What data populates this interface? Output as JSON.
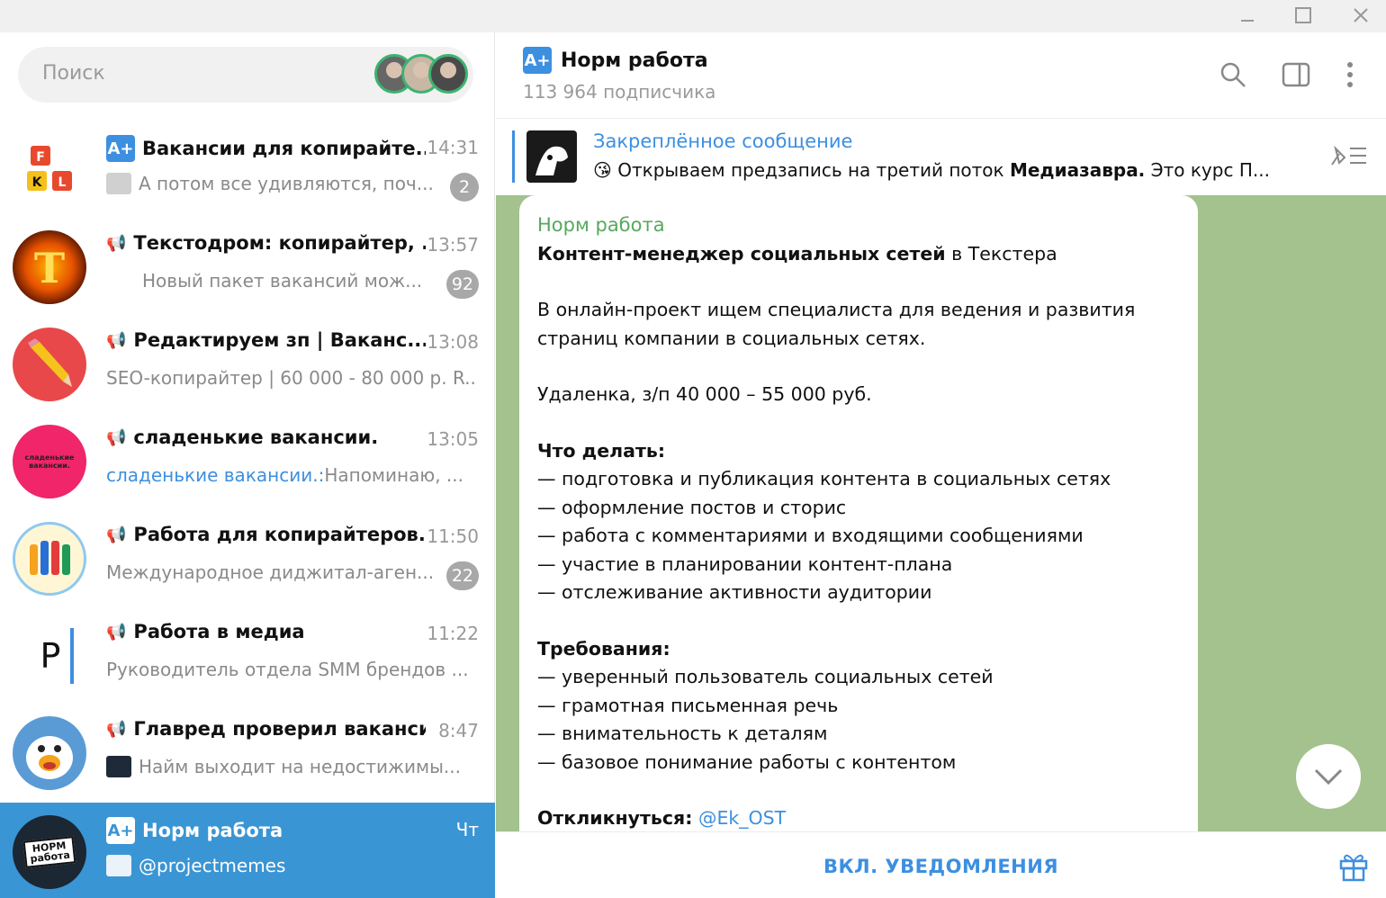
{
  "search": {
    "placeholder": "Поиск"
  },
  "chats": [
    {
      "name": "Вакансии для копирайте...",
      "time": "14:31",
      "preview": "А потом все удивляются,  поч...",
      "badge": "2",
      "icon": "a-plus-icon",
      "avatar_letters": [
        "F",
        "K",
        "L"
      ]
    },
    {
      "name": "Текстодром: копирайтер, ...",
      "time": "13:57",
      "preview": "Новый пакет вакансий мож...",
      "badge": "92",
      "icon": "megaphone-icon",
      "avatar_letters": [
        "T"
      ]
    },
    {
      "name": "Редактируем зп | Ваканс...",
      "time": "13:08",
      "preview": "SEO-копирайтер | 60 000 - 80 000 р. R...",
      "icon": "megaphone-icon"
    },
    {
      "name": "сладенькие вакансии.",
      "time": "13:05",
      "preview_sender": "сладенькие вакансии.:",
      "preview": " Напоминаю, ...",
      "icon": "megaphone-icon",
      "avatar_letters": [
        "сладенькие вакансии."
      ]
    },
    {
      "name": "Работа для копирайтеров...",
      "time": "11:50",
      "preview": "Международное диджитал-аген...",
      "badge": "22",
      "icon": "megaphone-icon"
    },
    {
      "name": "Работа в медиа",
      "time": "11:22",
      "preview": "Руководитель отдела SMM брендов ...",
      "icon": "megaphone-icon",
      "avatar_letters": [
        "Р"
      ]
    },
    {
      "name": "Главред проверил вакансию",
      "time": "8:47",
      "preview": "Найм выходит на недостижимы...",
      "icon": "megaphone-icon"
    },
    {
      "name": "Норм работа",
      "time": "Чт",
      "preview": "@projectmemes",
      "icon": "a-plus-icon",
      "active": true,
      "avatar_letters": [
        "НОРМ",
        "работа"
      ]
    }
  ],
  "header": {
    "title": "Норм работа",
    "subtitle": "113 964 подписчика"
  },
  "pinned": {
    "title": "Закреплённое сообщение",
    "text_before": " Открываем предзапись на третий поток ",
    "text_bold": "Медиазавра.",
    "text_after": " Это курс П..."
  },
  "message": {
    "from": "Норм работа",
    "title_bold": "Контент-менеджер социальных сетей",
    "title_rest": " в Текстера",
    "intro": "В онлайн-проект ищем специалиста для ведения и развития страниц компании в социальных сетях.",
    "salary": "Удаленка, з/п 40 000 – 55 000 руб.",
    "todo_title": "Что делать:",
    "todo": [
      "— подготовка и публикация контента в социальных сетях",
      "— оформление постов и сторис",
      "— работа с комментариями и входящими сообщениями",
      "— участие в планировании контент-плана",
      "— отслеживание активности аудитории"
    ],
    "req_title": "Требования:",
    "req": [
      "— уверенный пользователь социальных сетей",
      "— грамотная письменная речь",
      "— внимательность к деталям",
      "— базовое понимание работы с контентом"
    ],
    "respond_label": "Откликнуться:",
    "respond_link": "@Ek_OST"
  },
  "bottom": {
    "notify_label": "ВКЛ. УВЕДОМЛЕНИЯ"
  },
  "colors": {
    "accent": "#3d8fe0",
    "active_chat": "#3a95d4",
    "wallpaper": "#a3c28e",
    "sender": "#57a85d"
  }
}
